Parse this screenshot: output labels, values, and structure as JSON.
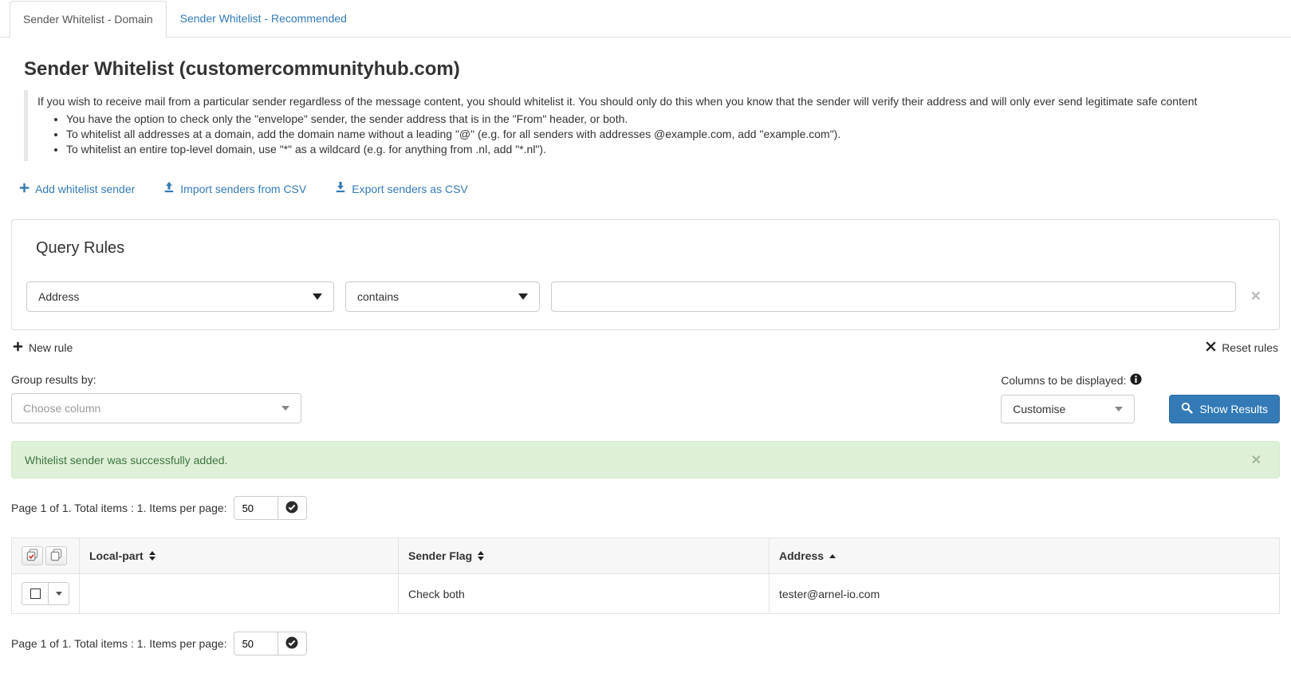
{
  "tabs": [
    {
      "label": "Sender Whitelist - Domain",
      "active": true
    },
    {
      "label": "Sender Whitelist - Recommended",
      "active": false
    }
  ],
  "page": {
    "title": "Sender Whitelist (customercommunityhub.com)"
  },
  "info": {
    "intro": "If you wish to receive mail from a particular sender regardless of the message content, you should whitelist it. You should only do this when you know that the sender will verify their address and will only ever send legitimate safe content",
    "bullets": [
      "You have the option to check only the \"envelope\" sender, the sender address that is in the \"From\" header, or both.",
      "To whitelist all addresses at a domain, add the domain name without a leading \"@\" (e.g. for all senders with addresses @example.com, add \"example.com\").",
      "To whitelist an entire top-level domain, use \"*\" as a wildcard (e.g. for anything from .nl, add \"*.nl\")."
    ]
  },
  "actions": {
    "add_label": "Add whitelist sender",
    "import_label": "Import senders from CSV",
    "export_label": "Export senders as CSV"
  },
  "query_rules": {
    "title": "Query Rules",
    "field_selected": "Address",
    "operator_selected": "contains",
    "value": "",
    "new_rule_label": "New rule",
    "reset_rules_label": "Reset rules"
  },
  "group_by": {
    "label": "Group results by:",
    "placeholder": "Choose column"
  },
  "columns_display": {
    "label": "Columns to be displayed:",
    "selected": "Customise",
    "show_results_label": "Show Results"
  },
  "alert": {
    "message": "Whitelist sender was successfully added."
  },
  "pagination": {
    "summary": "Page 1 of 1. Total items : 1. Items per page:",
    "per_page": "50"
  },
  "table": {
    "headers": {
      "local_part": "Local-part",
      "sender_flag": "Sender Flag",
      "address": "Address"
    },
    "rows": [
      {
        "local_part": "",
        "sender_flag": "Check both",
        "address": "tester@arnel-io.com"
      }
    ]
  },
  "colors": {
    "accent": "#337ab7",
    "success_bg": "#dff0d8",
    "success_text": "#3c763d"
  }
}
